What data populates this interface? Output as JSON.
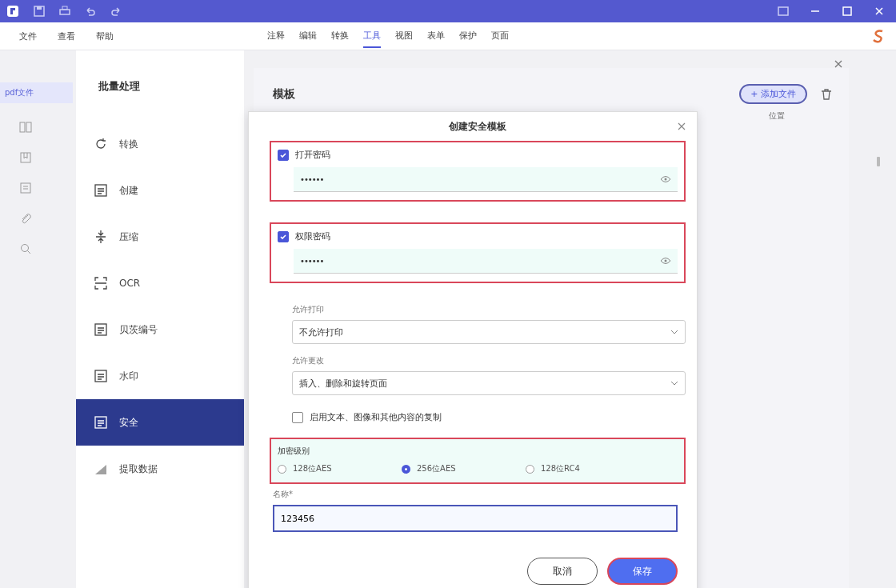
{
  "menu": [
    {
      "label": "文件"
    },
    {
      "label": "查看"
    },
    {
      "label": "帮助"
    }
  ],
  "ribbon_tabs": [
    {
      "label": "注释",
      "selected": false
    },
    {
      "label": "编辑",
      "selected": false
    },
    {
      "label": "转换",
      "selected": false
    },
    {
      "label": "工具",
      "selected": true
    },
    {
      "label": "视图",
      "selected": false
    },
    {
      "label": "表单",
      "selected": false
    },
    {
      "label": "保护",
      "selected": false
    },
    {
      "label": "页面",
      "selected": false
    }
  ],
  "document_tab": {
    "label": "pdf文件"
  },
  "batch_panel": {
    "title": "批量处理",
    "items": [
      {
        "label": "转换",
        "selected": false
      },
      {
        "label": "创建",
        "selected": false
      },
      {
        "label": "压缩",
        "selected": false
      },
      {
        "label": "OCR",
        "selected": false
      },
      {
        "label": "贝茨编号",
        "selected": false
      },
      {
        "label": "水印",
        "selected": false
      },
      {
        "label": "安全",
        "selected": true
      },
      {
        "label": "提取数据",
        "selected": false
      }
    ]
  },
  "main": {
    "heading": "模板",
    "add_button": "+ 添加文件",
    "column": "位置"
  },
  "dialog": {
    "title": "创建安全模板",
    "open_password": {
      "label": "打开密码",
      "checked": true,
      "value": "••••••"
    },
    "permission_password": {
      "label": "权限密码",
      "checked": true,
      "value": "••••••"
    },
    "print_allowed": {
      "label": "允许打印",
      "value": "不允许打印"
    },
    "changes_allowed": {
      "label": "允许更改",
      "value": "插入、删除和旋转页面"
    },
    "copy_option": {
      "label": "启用文本、图像和其他内容的复制",
      "checked": false
    },
    "encryption": {
      "label": "加密级别",
      "options": [
        {
          "label": "128位AES",
          "selected": false
        },
        {
          "label": "256位AES",
          "selected": true
        },
        {
          "label": "128位RC4",
          "selected": false
        }
      ]
    },
    "name": {
      "label": "名称*",
      "value": "123456"
    },
    "buttons": [
      {
        "label": "取消",
        "kind": "secondary"
      },
      {
        "label": "保存",
        "kind": "primary"
      }
    ]
  }
}
